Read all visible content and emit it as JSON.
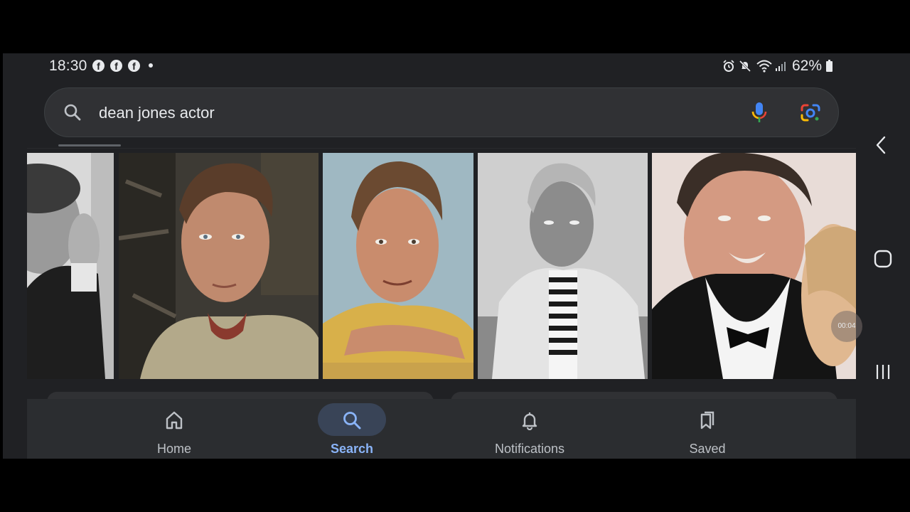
{
  "status_bar": {
    "time": "18:30",
    "notification_icons": [
      "facebook-icon",
      "facebook-icon",
      "facebook-icon"
    ],
    "battery": "62%",
    "system_icons": [
      "alarm-icon",
      "mute-icon",
      "wifi-icon",
      "signal-icon",
      "battery-icon"
    ]
  },
  "search": {
    "query": "dean jones actor",
    "left_icon": "search-icon",
    "right_icons": [
      "mic-icon",
      "google-lens-icon"
    ]
  },
  "images": {
    "tiles": [
      {
        "description_icon": "photo-icon"
      },
      {
        "description_icon": "photo-icon"
      },
      {
        "description_icon": "photo-icon"
      },
      {
        "description_icon": "photo-icon"
      },
      {
        "description_icon": "photo-icon"
      }
    ],
    "video_timer": "00:04"
  },
  "bottom_nav": {
    "items": [
      {
        "label": "Home",
        "icon": "home-icon",
        "active": false
      },
      {
        "label": "Search",
        "icon": "search-icon",
        "active": true
      },
      {
        "label": "Notifications",
        "icon": "bell-icon",
        "active": false
      },
      {
        "label": "Saved",
        "icon": "bookmarks-icon",
        "active": false
      }
    ]
  },
  "system_nav": {
    "icons": [
      "back-icon",
      "home-circle-icon",
      "recent-apps-icon"
    ]
  },
  "colors": {
    "background": "#202124",
    "accent": "#8ab4f8",
    "nav_active_pill": "#394457"
  }
}
